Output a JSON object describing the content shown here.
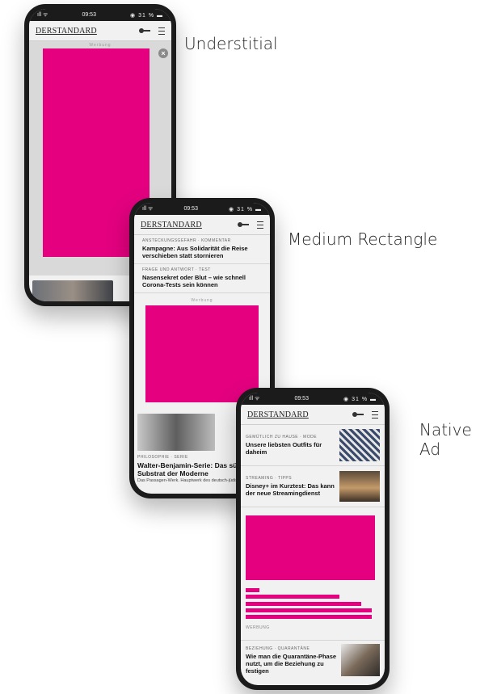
{
  "labels": {
    "understitial": "Understitial",
    "medium_rectangle": "Medium Rectangle",
    "native_ad": "Native Ad"
  },
  "status_bar": {
    "time": "09:53",
    "signal": "ıll ᯤ",
    "battery": "◉ 31 % ▬"
  },
  "brand": "DERSTANDARD",
  "ad_marker": "Werbung",
  "close_glyph": "×",
  "phone1": {},
  "phone2": {
    "articles": [
      {
        "kicker": "Ansteckungsgefahr · Kommentar",
        "headline": "Kampagne: Aus Solidarität die Reise verschieben statt stornieren"
      },
      {
        "kicker": "Frage und Antwort · Test",
        "headline": "Nasensekret oder Blut – wie schnell Corona-Tests sein können"
      }
    ],
    "feature_kicker": "Philosophie · Serie",
    "feature_headline": "Walter-Benjamin-Serie: Das süße Substrat der Moderne",
    "feature_teaser": "Das Passagen-Werk. Hauptwerk des deutsch-jüdischen Philosophen"
  },
  "phone3": {
    "articles": [
      {
        "kicker": "Gemütlich zu Hause · Mode",
        "headline": "Unsere liebsten Outfits für daheim"
      },
      {
        "kicker": "Streaming · Tipps",
        "headline": "Disney+ im Kurztest: Das kann der neue Streamingdienst"
      }
    ],
    "native_marker": "Werbung",
    "bottom_article": {
      "kicker": "Beziehung · Quarantäne",
      "headline": "Wie man die Quarantäne-Phase nutzt, um die Beziehung zu festigen"
    }
  }
}
